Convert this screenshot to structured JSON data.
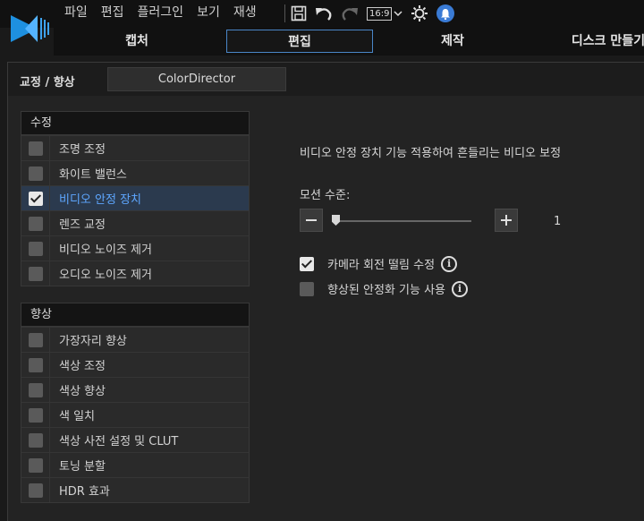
{
  "menu": [
    "파일",
    "편집",
    "플러그인",
    "보기",
    "재생"
  ],
  "toolbar": {
    "ratio_label": "16:9"
  },
  "tabs": [
    {
      "label": "캡처"
    },
    {
      "label": "편집"
    },
    {
      "label": "제작"
    },
    {
      "label": "디스크 만들기"
    }
  ],
  "panel": {
    "breadcrumb": "교정 / 향상",
    "colordirector_label": "ColorDirector"
  },
  "fix_group": {
    "title": "수정",
    "items": [
      {
        "label": "조명 조정",
        "checked": false
      },
      {
        "label": "화이트 밸런스",
        "checked": false
      },
      {
        "label": "비디오 안정 장치",
        "checked": true,
        "selected": true
      },
      {
        "label": "렌즈 교정",
        "checked": false
      },
      {
        "label": "비디오 노이즈 제거",
        "checked": false
      },
      {
        "label": "오디오 노이즈 제거",
        "checked": false
      }
    ]
  },
  "enhance_group": {
    "title": "향상",
    "items": [
      {
        "label": "가장자리 향상",
        "checked": false
      },
      {
        "label": "색상 조정",
        "checked": false
      },
      {
        "label": "색상 향상",
        "checked": false
      },
      {
        "label": "색 일치",
        "checked": false
      },
      {
        "label": "색상 사전 설정 및 CLUT",
        "checked": false
      },
      {
        "label": "토닝 분할",
        "checked": false
      },
      {
        "label": "HDR 효과",
        "checked": false
      }
    ]
  },
  "stabilizer": {
    "description": "비디오 안정 장치 기능 적용하여 흔들리는 비디오 보정",
    "motion_label": "모션 수준:",
    "motion_value": "1",
    "options": [
      {
        "label": "카메라 회전 떨림 수정",
        "checked": true
      },
      {
        "label": "향상된 안정화 기능 사용",
        "checked": false
      }
    ]
  }
}
